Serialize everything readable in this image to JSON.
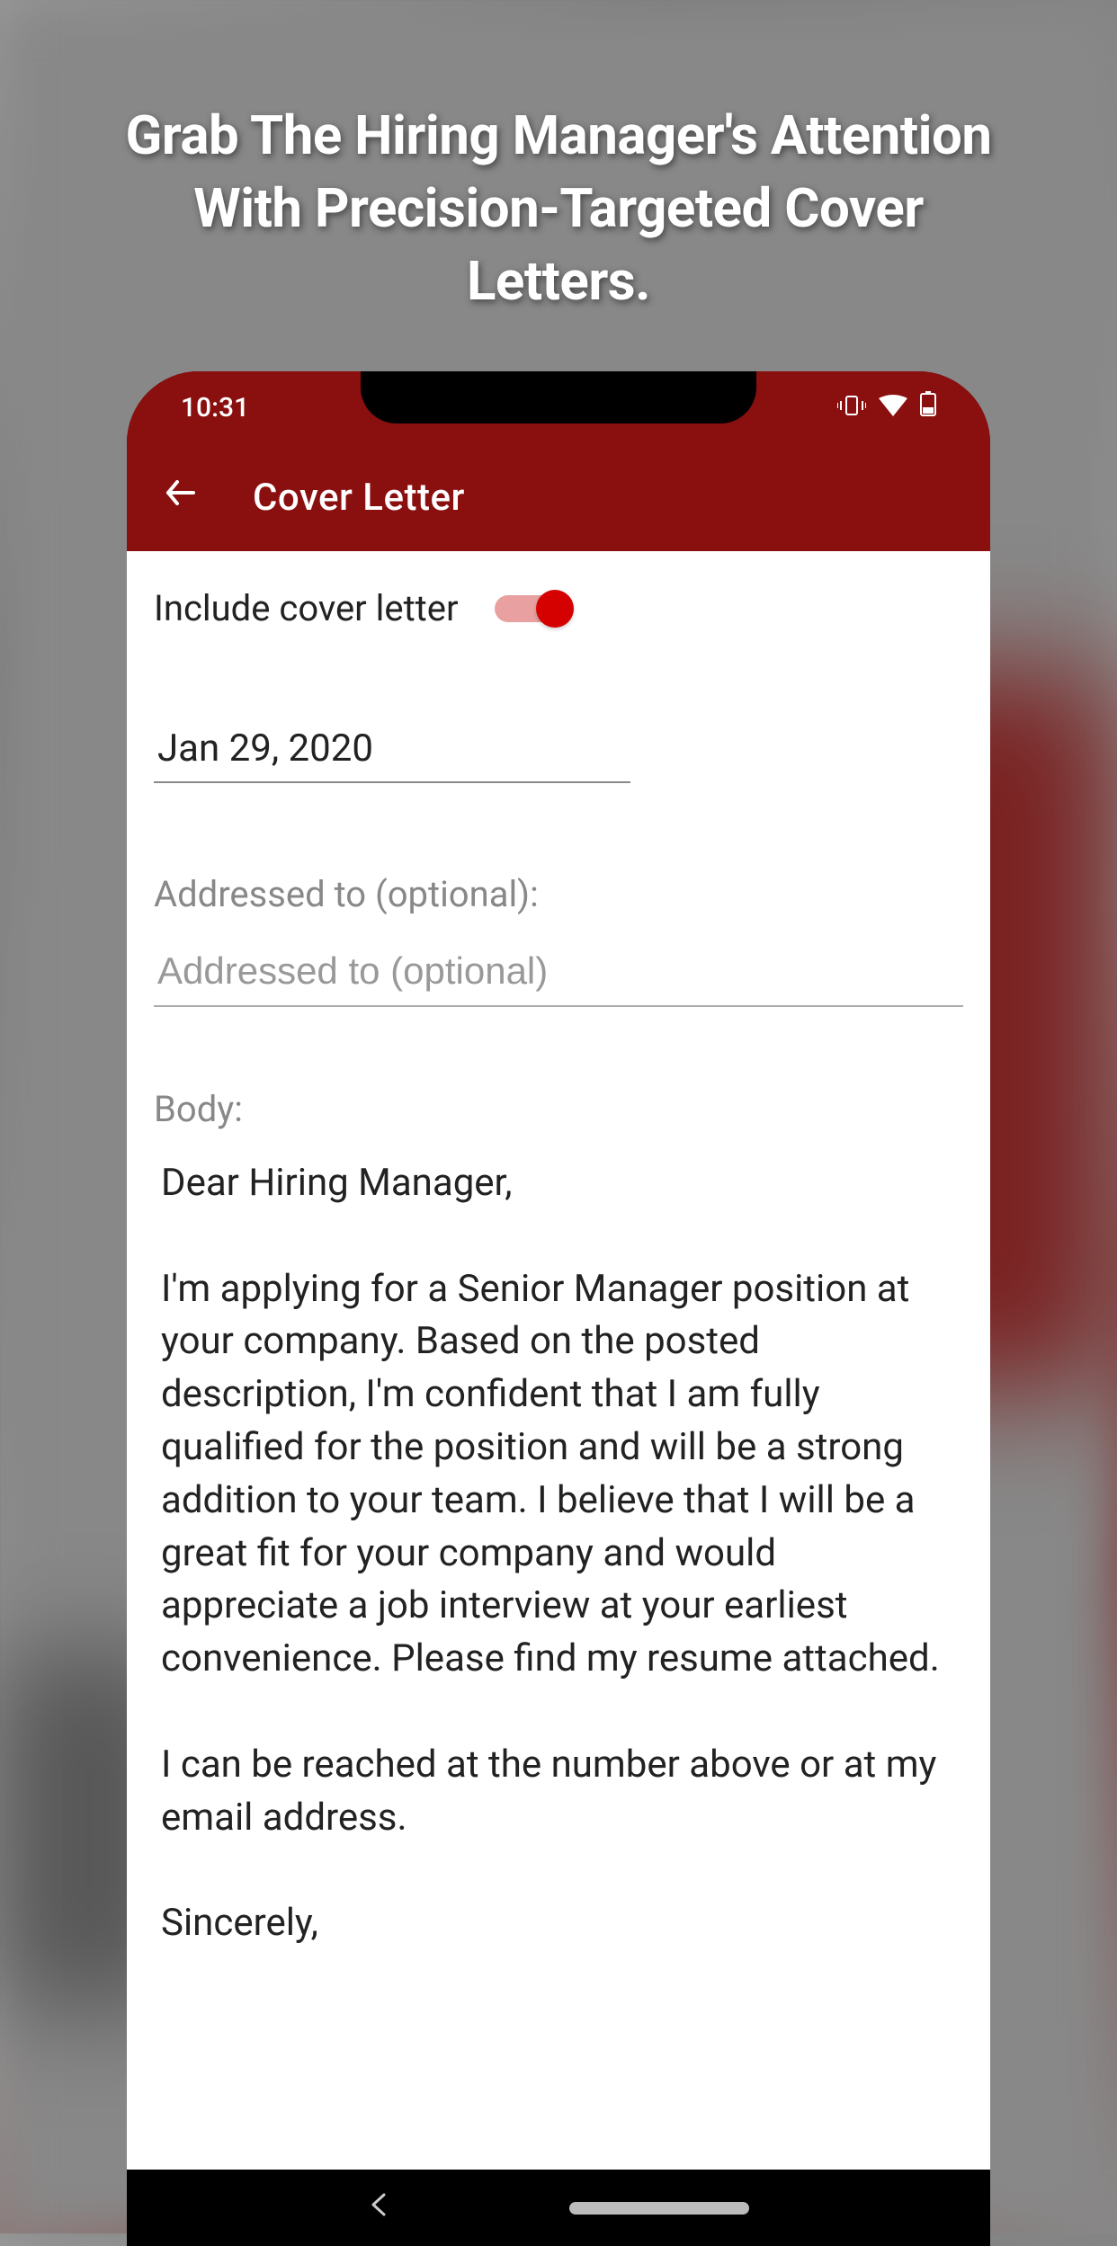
{
  "overlay": {
    "title": "Grab The Hiring Manager's Attention With Precision-Targeted Cover Letters."
  },
  "status": {
    "time": "10:31"
  },
  "app_bar": {
    "title": "Cover Letter"
  },
  "form": {
    "include_label": "Include cover letter",
    "include_value": true,
    "date_value": "Jan 29, 2020",
    "addressed_label": "Addressed to (optional):",
    "addressed_placeholder": "Addressed to (optional)",
    "addressed_value": "",
    "body_label": "Body:",
    "body_text": "Dear Hiring Manager,\n\nI'm applying for a Senior Manager position at your company. Based on the posted description, I'm confident that I am fully qualified for the position and will be a strong addition to your team. I believe that I will be a great fit for your company and would appreciate a job interview at your earliest convenience. Please find my resume attached.\n\nI can be reached at the number above or at my email address.\n\nSincerely,"
  }
}
